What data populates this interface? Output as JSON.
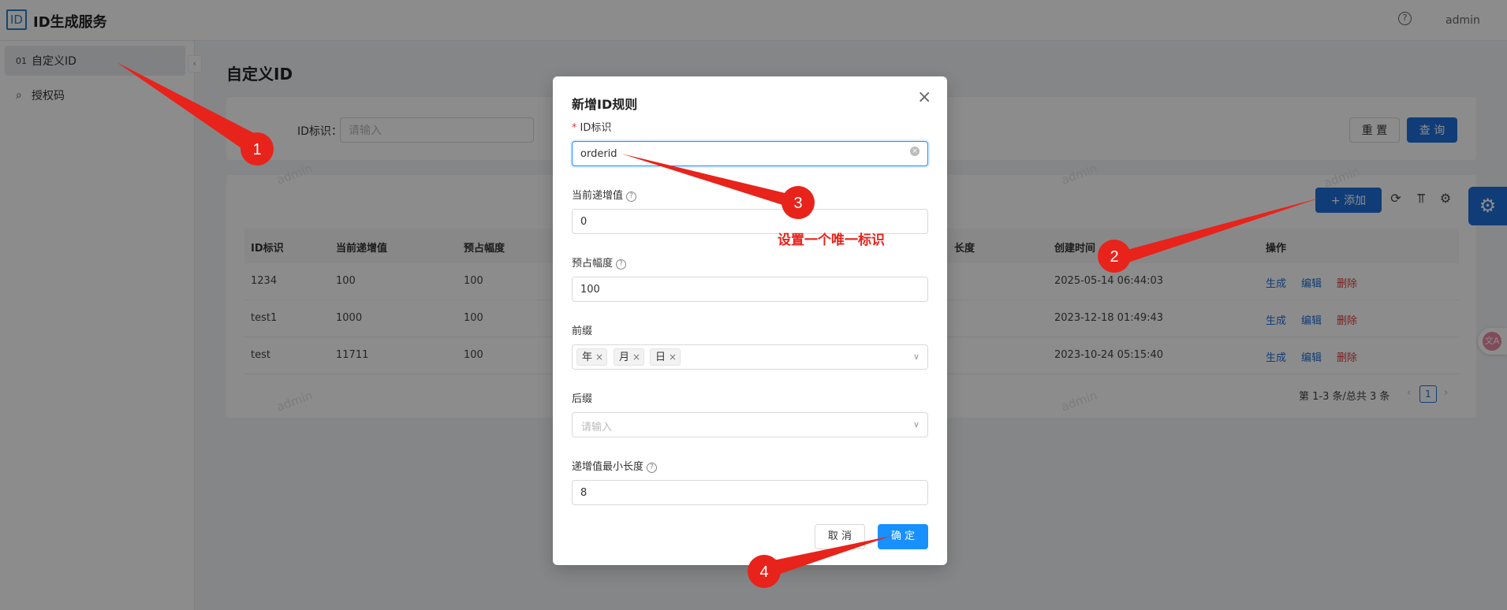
{
  "app": {
    "logo": "ID",
    "title": "ID生成服务",
    "user": "admin",
    "help": "?"
  },
  "sidebar": {
    "items": [
      {
        "icon": "01",
        "label": "自定义ID"
      },
      {
        "icon": "⌕",
        "label": "授权码"
      }
    ],
    "collapse": "‹"
  },
  "page": {
    "title": "自定义ID"
  },
  "search": {
    "label": "ID标识：",
    "placeholder": "请输入",
    "reset": "重 置",
    "query": "查 询"
  },
  "toolbar": {
    "add": "+ 添加"
  },
  "table": {
    "headers": [
      "ID标识",
      "当前递增值",
      "预占幅度",
      "长度",
      "创建时间",
      "操作"
    ],
    "rows": [
      {
        "id": "1234",
        "current": "100",
        "reserve": "100",
        "created": "2025-05-14 06:44:03"
      },
      {
        "id": "test1",
        "current": "1000",
        "reserve": "100",
        "created": "2023-12-18 01:49:43"
      },
      {
        "id": "test",
        "current": "11711",
        "reserve": "100",
        "created": "2023-10-24 05:15:40"
      }
    ],
    "ops": {
      "generate": "生成",
      "edit": "编辑",
      "delete": "删除"
    }
  },
  "pager": {
    "summary": "第 1-3 条/总共 3 条",
    "current": "1",
    "prev": "‹",
    "next": "›"
  },
  "watermark": "admin",
  "translate": "文A",
  "modal": {
    "title": "新增ID规则",
    "close": "×",
    "fields": {
      "id_label": "ID标识",
      "id_value": "orderid",
      "current_label": "当前递增值",
      "current_value": "0",
      "reserve_label": "预占幅度",
      "reserve_value": "100",
      "prefix_label": "前缀",
      "prefix_tags": [
        "年",
        "月",
        "日"
      ],
      "suffix_label": "后缀",
      "suffix_placeholder": "请输入",
      "minlen_label": "递增值最小长度",
      "minlen_value": "8"
    },
    "cancel": "取 消",
    "ok": "确 定"
  },
  "annotations": {
    "color": "#e8231b",
    "steps": [
      "1",
      "2",
      "3",
      "4"
    ],
    "note": "设置一个唯一标识"
  }
}
